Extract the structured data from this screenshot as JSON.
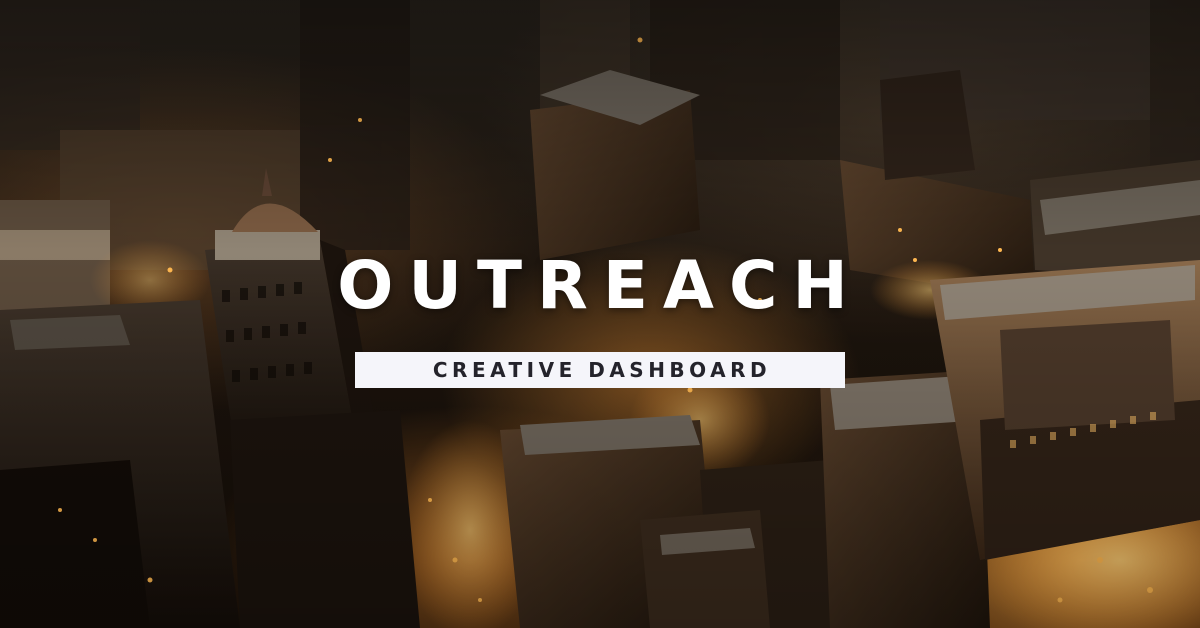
{
  "banner": {
    "title": "OUTREACH",
    "subtitle": "CREATIVE DASHBOARD"
  },
  "background": {
    "scene": "city-aerial-night",
    "palette": {
      "shadow": "#150d07",
      "mid": "#3a2a1c",
      "glow": "#ffb048",
      "highlight": "#ffd68a"
    }
  }
}
